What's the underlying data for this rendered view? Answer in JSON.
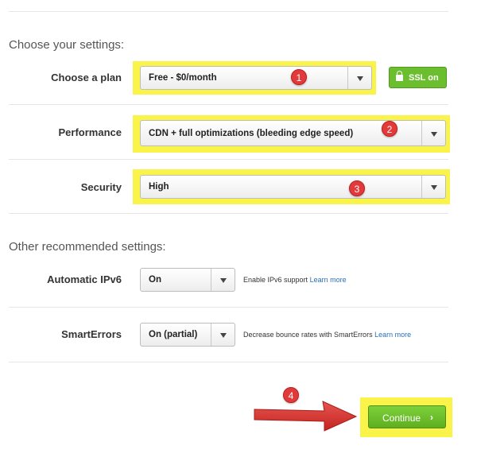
{
  "settings": {
    "heading": "Choose your settings:",
    "plan": {
      "label": "Choose a plan",
      "value": "Free - $0/month",
      "badge": "1",
      "ssl_label": "SSL on"
    },
    "performance": {
      "label": "Performance",
      "value": "CDN + full optimizations (bleeding edge speed)",
      "badge": "2"
    },
    "security": {
      "label": "Security",
      "value": "High",
      "badge": "3"
    }
  },
  "recommended": {
    "heading": "Other recommended settings:",
    "ipv6": {
      "label": "Automatic IPv6",
      "value": "On",
      "help": "Enable IPv6 support",
      "link": "Learn more"
    },
    "smarterrors": {
      "label": "SmartErrors",
      "value": "On (partial)",
      "help": "Decrease bounce rates with SmartErrors",
      "link": "Learn more"
    }
  },
  "footer": {
    "badge": "4",
    "continue_label": "Continue",
    "continue_chevron": "›"
  },
  "colors": {
    "highlight": "#faf34a",
    "badge": "#e23a3a",
    "green": "#6bbf2e",
    "link": "#2a6ebb",
    "arrow": "#d9302c"
  },
  "icons": [
    "lock-icon",
    "chevron-down-icon",
    "chevron-right-icon",
    "red-arrow-icon"
  ]
}
